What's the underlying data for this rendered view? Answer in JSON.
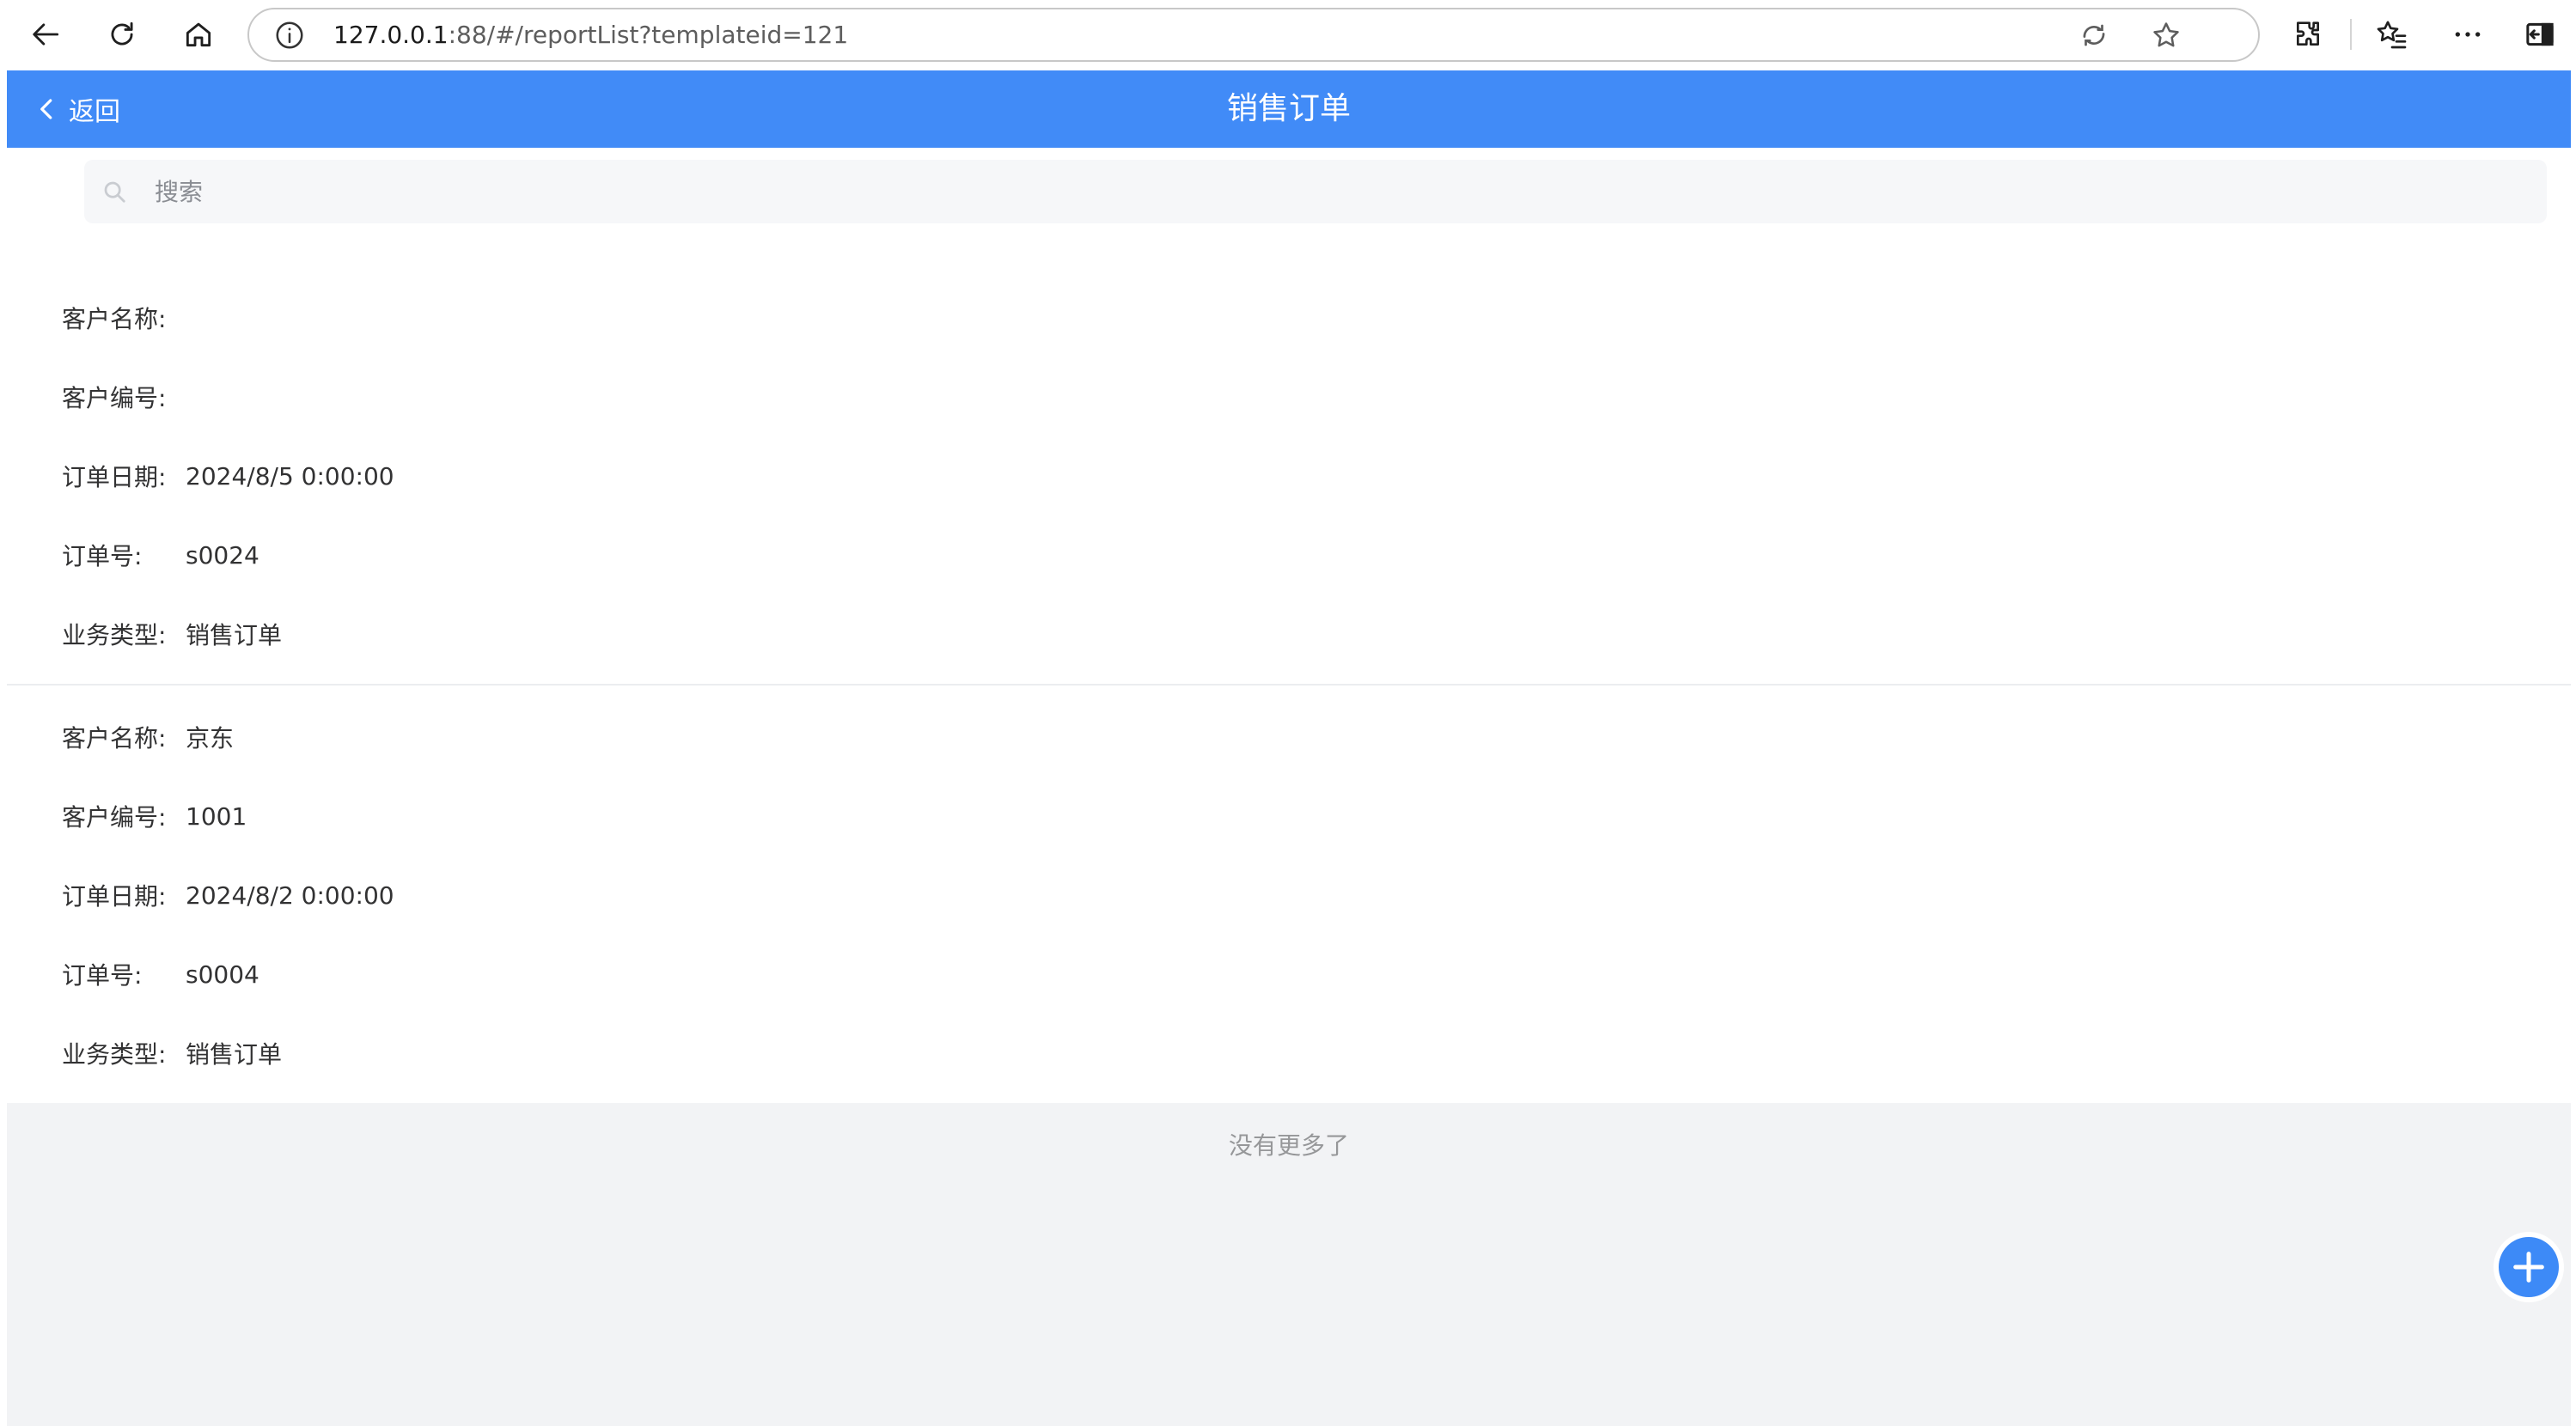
{
  "browser": {
    "url_host": "127.0.0.1",
    "url_rest": ":88/#/reportList?templateid=121"
  },
  "header": {
    "back_label": "返回",
    "title": "销售订单"
  },
  "search": {
    "placeholder": "搜索"
  },
  "orders": [
    {
      "fields": [
        {
          "label": "客户名称:",
          "value": ""
        },
        {
          "label": "客户编号:",
          "value": ""
        },
        {
          "label": "订单日期:",
          "value": "2024/8/5 0:00:00"
        },
        {
          "label": "订单号:",
          "value": "s0024"
        },
        {
          "label": "业务类型:",
          "value": "销售订单"
        }
      ]
    },
    {
      "fields": [
        {
          "label": "客户名称:",
          "value": "京东"
        },
        {
          "label": "客户编号:",
          "value": "1001"
        },
        {
          "label": "订单日期:",
          "value": "2024/8/2 0:00:00"
        },
        {
          "label": "订单号:",
          "value": "s0004"
        },
        {
          "label": "业务类型:",
          "value": "销售订单"
        }
      ]
    }
  ],
  "footer": {
    "no_more_text": "没有更多了"
  },
  "colors": {
    "header_blue": "#418bf7",
    "fab_blue": "#3d8af7"
  }
}
